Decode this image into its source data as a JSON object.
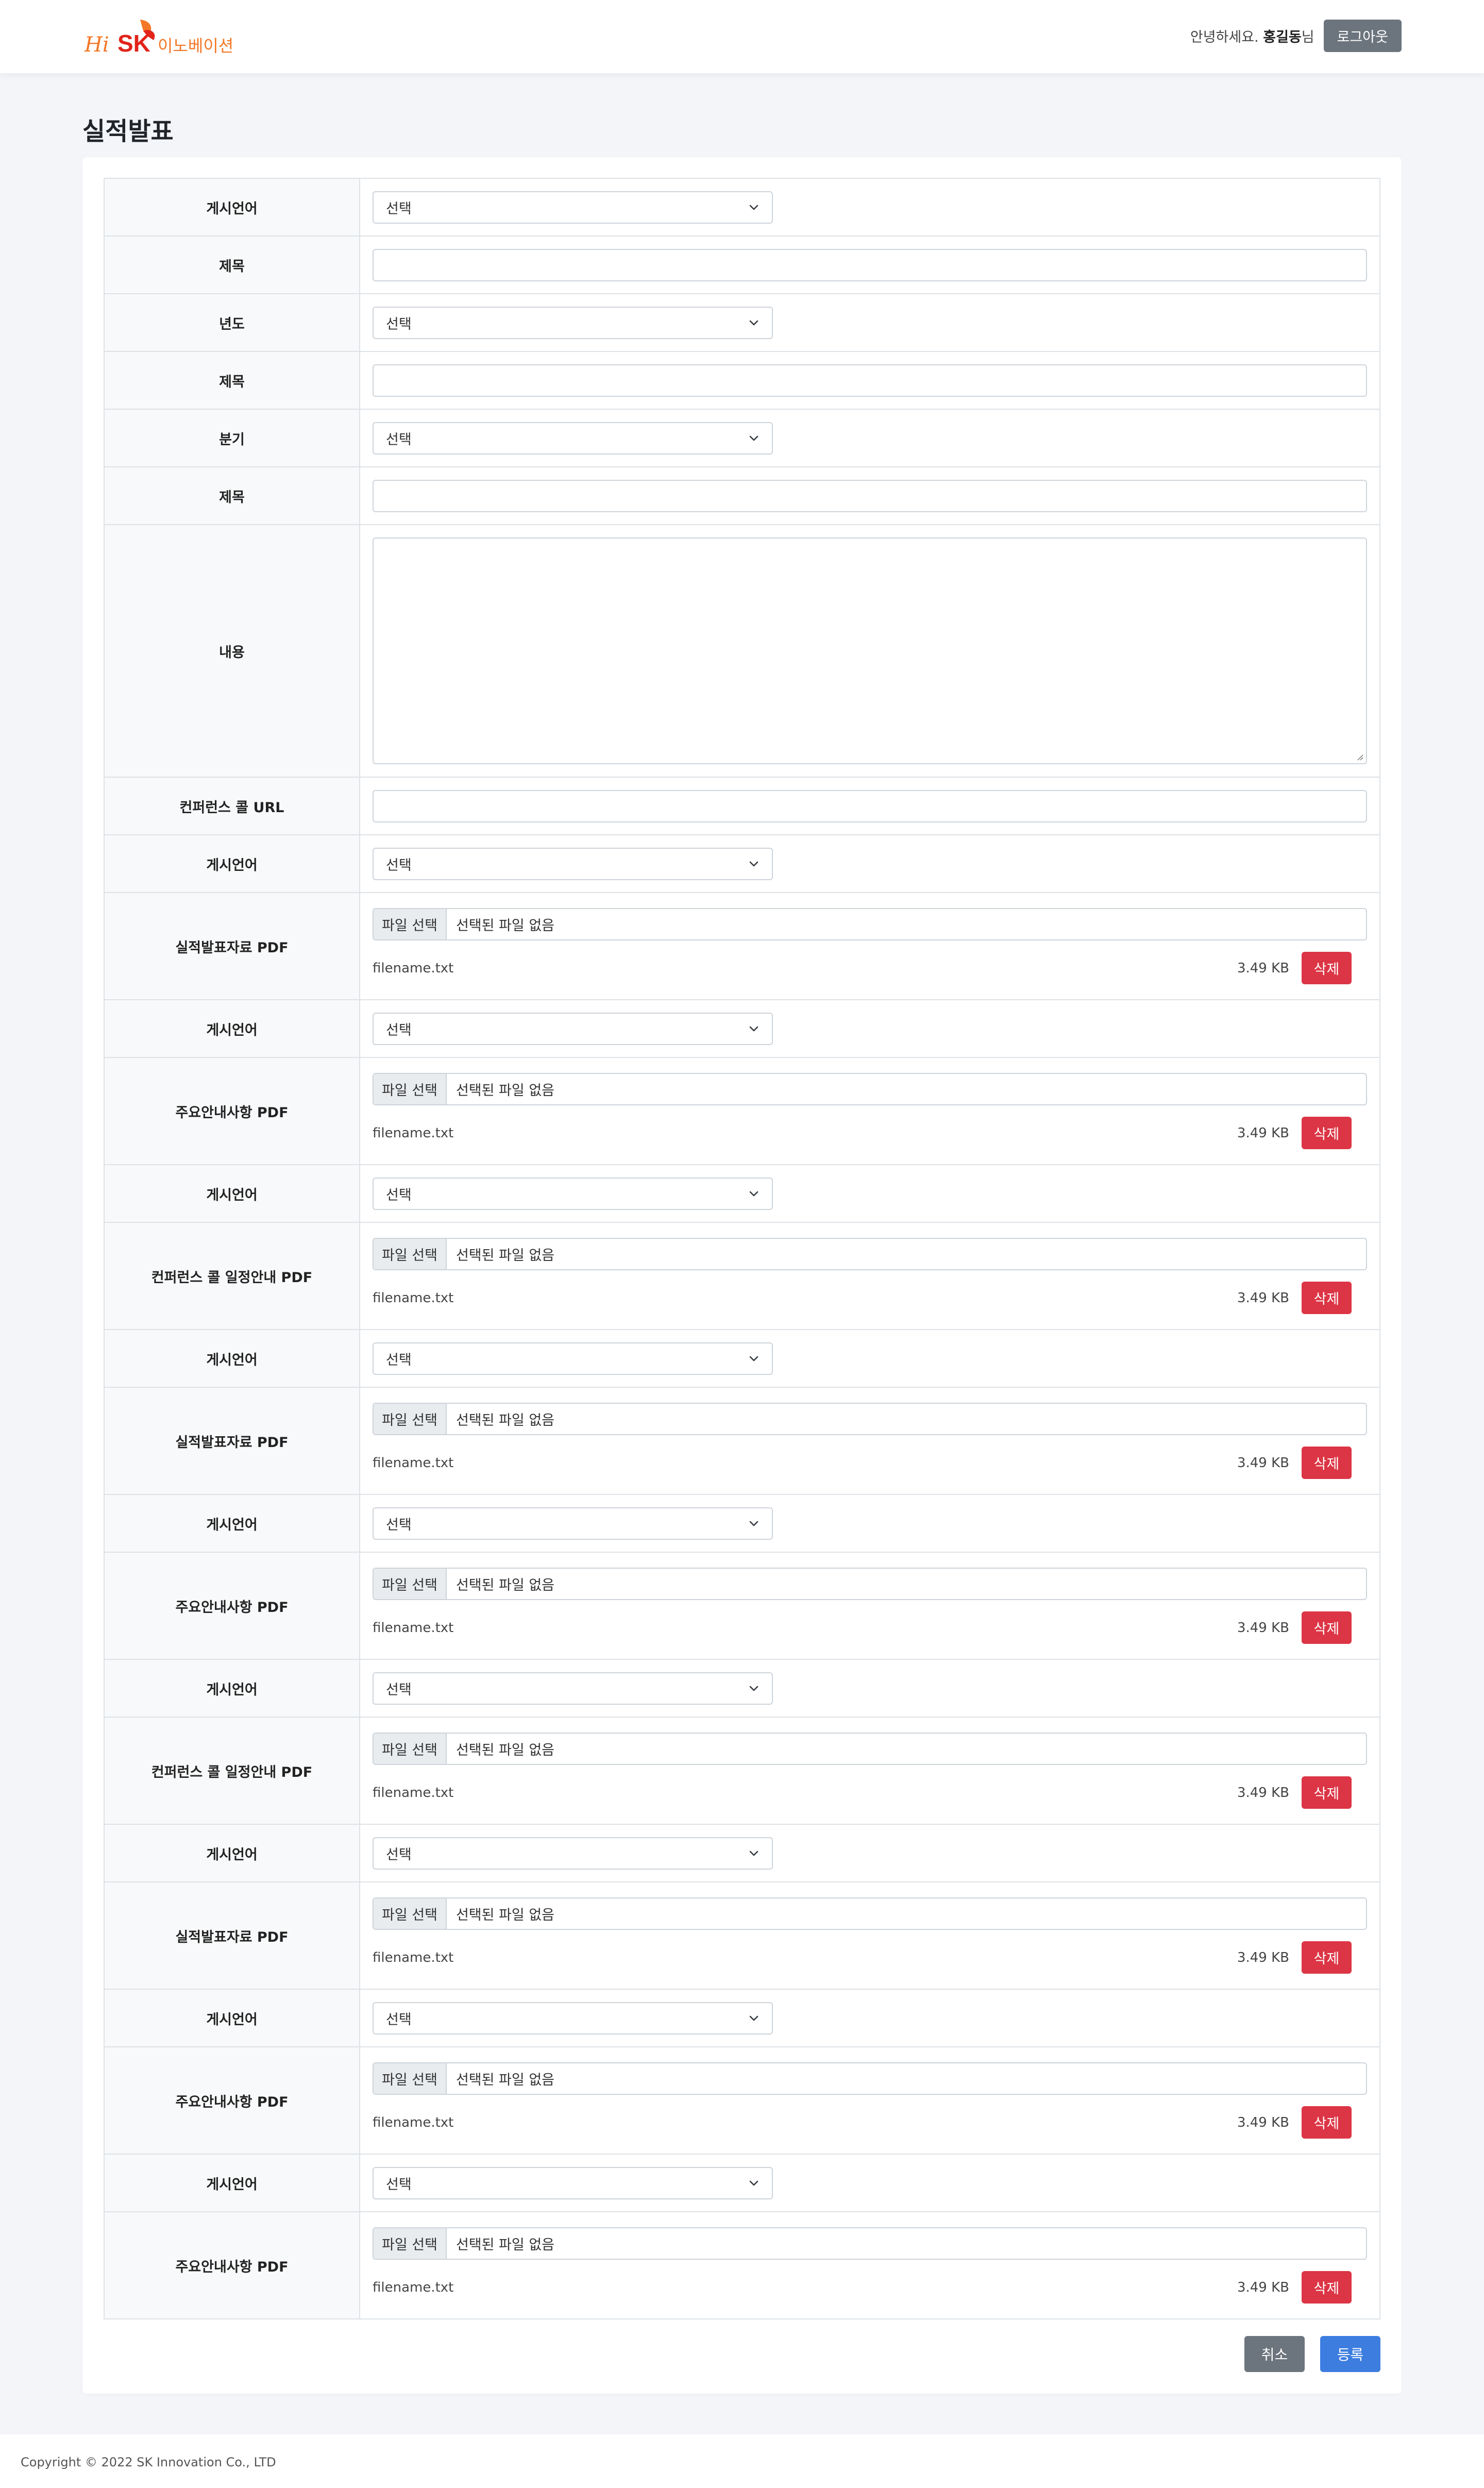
{
  "header": {
    "logo_text": "Hi SK 이노베이션",
    "greeting_prefix": "안녕하세요.",
    "user_name": "홍길동",
    "greeting_suffix": "님",
    "logout_label": "로그아웃"
  },
  "page": {
    "title": "실적발표"
  },
  "form": {
    "language1": {
      "label": "게시언어",
      "value": "선택"
    },
    "title1": {
      "label": "제목",
      "value": ""
    },
    "year": {
      "label": "년도",
      "value": "선택"
    },
    "title2": {
      "label": "제목",
      "value": ""
    },
    "quarter": {
      "label": "분기",
      "value": "선택"
    },
    "title3": {
      "label": "제목",
      "value": ""
    },
    "content": {
      "label": "내용",
      "value": ""
    },
    "conf_url": {
      "label": "컨퍼런스 콜 URL",
      "value": ""
    },
    "file_rows": [
      {
        "lang_label": "게시언어",
        "lang_value": "선택",
        "file_label": "실적발표자료 PDF",
        "button": "파일 선택",
        "status": "선택된 파일 없음",
        "filename": "filename.txt",
        "size": "3.49 KB",
        "delete": "삭제"
      },
      {
        "lang_label": "게시언어",
        "lang_value": "선택",
        "file_label": "주요안내사항 PDF",
        "button": "파일 선택",
        "status": "선택된 파일 없음",
        "filename": "filename.txt",
        "size": "3.49 KB",
        "delete": "삭제"
      },
      {
        "lang_label": "게시언어",
        "lang_value": "선택",
        "file_label": "컨퍼런스 콜 일정안내 PDF",
        "button": "파일 선택",
        "status": "선택된 파일 없음",
        "filename": "filename.txt",
        "size": "3.49 KB",
        "delete": "삭제"
      },
      {
        "lang_label": "게시언어",
        "lang_value": "선택",
        "file_label": "실적발표자료 PDF",
        "button": "파일 선택",
        "status": "선택된 파일 없음",
        "filename": "filename.txt",
        "size": "3.49 KB",
        "delete": "삭제"
      },
      {
        "lang_label": "게시언어",
        "lang_value": "선택",
        "file_label": "주요안내사항 PDF",
        "button": "파일 선택",
        "status": "선택된 파일 없음",
        "filename": "filename.txt",
        "size": "3.49 KB",
        "delete": "삭제"
      },
      {
        "lang_label": "게시언어",
        "lang_value": "선택",
        "file_label": "컨퍼런스 콜 일정안내 PDF",
        "button": "파일 선택",
        "status": "선택된 파일 없음",
        "filename": "filename.txt",
        "size": "3.49 KB",
        "delete": "삭제"
      },
      {
        "lang_label": "게시언어",
        "lang_value": "선택",
        "file_label": "실적발표자료 PDF",
        "button": "파일 선택",
        "status": "선택된 파일 없음",
        "filename": "filename.txt",
        "size": "3.49 KB",
        "delete": "삭제"
      },
      {
        "lang_label": "게시언어",
        "lang_value": "선택",
        "file_label": "주요안내사항 PDF",
        "button": "파일 선택",
        "status": "선택된 파일 없음",
        "filename": "filename.txt",
        "size": "3.49 KB",
        "delete": "삭제"
      },
      {
        "lang_label": "게시언어",
        "lang_value": "선택",
        "file_label": "주요안내사항 PDF",
        "button": "파일 선택",
        "status": "선택된 파일 없음",
        "filename": "filename.txt",
        "size": "3.49 KB",
        "delete": "삭제"
      }
    ]
  },
  "actions": {
    "cancel_label": "취소",
    "submit_label": "등록"
  },
  "footer": {
    "copyright": "Copyright © 2022 SK Innovation Co., LTD"
  },
  "colors": {
    "brand_orange": "#f47725",
    "brand_red": "#e2231a",
    "delete": "#dc3545",
    "submit": "#3d7de0",
    "secondary": "#6c757d"
  }
}
